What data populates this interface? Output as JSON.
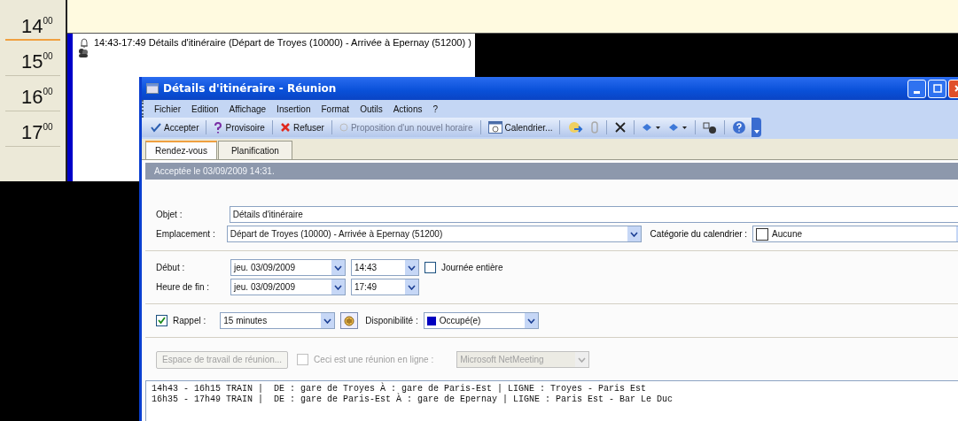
{
  "calendar": {
    "hours": [
      {
        "hour": "14",
        "minutes": "00",
        "selected": true
      },
      {
        "hour": "15",
        "minutes": "00",
        "selected": false
      },
      {
        "hour": "16",
        "minutes": "00",
        "selected": false
      },
      {
        "hour": "17",
        "minutes": "00",
        "selected": false
      }
    ],
    "appointment": {
      "text": "14:43-17:49 Détails d'itinéraire (Départ de Troyes (10000)  - Arrivée à Epernay (51200) )"
    }
  },
  "window": {
    "title": "Détails d'itinéraire - Réunion"
  },
  "menu": [
    "Fichier",
    "Edition",
    "Affichage",
    "Insertion",
    "Format",
    "Outils",
    "Actions",
    "?"
  ],
  "toolbar": [
    {
      "label": "Accepter",
      "kind": "accept",
      "disabled": false
    },
    {
      "label": "Provisoire",
      "kind": "tentative",
      "disabled": false
    },
    {
      "label": "Refuser",
      "kind": "decline",
      "disabled": false
    },
    {
      "label": "Proposition d'un nouvel horaire",
      "kind": "propose",
      "disabled": true
    },
    {
      "label": "Calendrier...",
      "kind": "calendar",
      "disabled": false
    }
  ],
  "tabs": [
    {
      "label": "Rendez-vous",
      "selected": true
    },
    {
      "label": "Planification",
      "selected": false
    }
  ],
  "info_bar": "Acceptée le 03/09/2009 14:31.",
  "subject": {
    "label": "Objet :",
    "value": "Détails d'itinéraire"
  },
  "location": {
    "label": "Emplacement :",
    "value": "Départ de Troyes (10000)  - Arrivée à Epernay (51200)"
  },
  "category": {
    "label": "Catégorie du calendrier :",
    "value": "Aucune"
  },
  "start": {
    "label": "Début :",
    "date": "jeu. 03/09/2009",
    "time": "14:43"
  },
  "all_day": {
    "label": "Journée entière",
    "checked": false
  },
  "end": {
    "label": "Heure de fin :",
    "date": "jeu. 03/09/2009",
    "time": "17:49"
  },
  "reminder": {
    "label": "Rappel :",
    "checked": true,
    "value": "15 minutes"
  },
  "availability": {
    "label": "Disponibilité :",
    "value": "Occupé(e)",
    "color": "#0000c0"
  },
  "workspace_button": {
    "label": "Espace de travail de réunion...",
    "disabled": true
  },
  "online_meeting": {
    "label": "Ceci est une réunion en ligne :",
    "checked": false,
    "disabled": true,
    "value": "Microsoft NetMeeting"
  },
  "notes": [
    "14h43 - 16h15 TRAIN |  DE : gare de Troyes À : gare de Paris-Est | LIGNE : Troyes - Paris Est",
    "16h35 - 17h49 TRAIN |  DE : gare de Paris-Est À : gare de Epernay | LIGNE : Paris Est - Bar Le Duc"
  ]
}
